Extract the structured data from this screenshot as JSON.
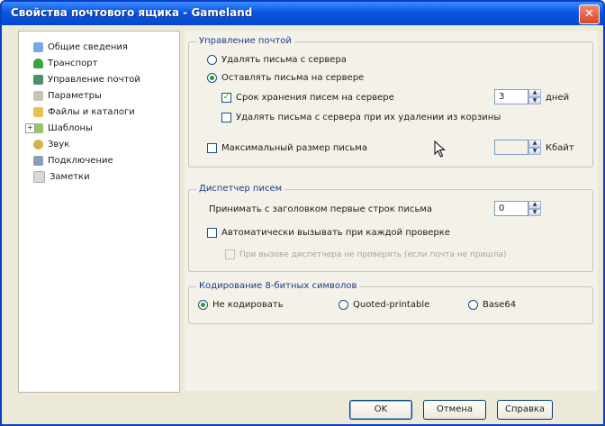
{
  "window": {
    "title": "Свойства почтового ящика - Gameland",
    "close_glyph": "✕"
  },
  "tree": {
    "items": [
      {
        "label": "Общие сведения",
        "icon": "info-icon"
      },
      {
        "label": "Транспорт",
        "icon": "transport-icon"
      },
      {
        "label": "Управление почтой",
        "icon": "mail-management-icon"
      },
      {
        "label": "Параметры",
        "icon": "parameters-icon"
      },
      {
        "label": "Файлы и каталоги",
        "icon": "folder-icon"
      },
      {
        "label": "Шаблоны",
        "icon": "templates-icon",
        "expander": "+"
      },
      {
        "label": "Звук",
        "icon": "sound-icon"
      },
      {
        "label": "Подключение",
        "icon": "connection-icon"
      },
      {
        "label": "Заметки",
        "icon": "notes-icon"
      }
    ]
  },
  "mail_group": {
    "legend": "Управление почтой",
    "radio_delete": "Удалять письма с сервера",
    "radio_keep": "Оставлять письма на сервере",
    "check_storage": "Срок хранения писем на сервере",
    "storage_value": "3",
    "storage_unit": "дней",
    "check_delete_from_trash": "Удалять письма с сервера при их удалении из корзины",
    "check_max_size": "Максимальный размер письма",
    "max_size_value": "",
    "max_size_unit": "Кбайт"
  },
  "dispatcher_group": {
    "legend": "Диспетчер писем",
    "receive_lines_label": "Принимать с заголовком первые строк письма",
    "receive_lines_value": "0",
    "check_auto_call": "Автоматически вызывать при каждой проверке",
    "disabled_option": "При вызове диспетчера не проверять (если почта не пришла)"
  },
  "encoding_group": {
    "legend": "Кодирование 8-битных символов",
    "options": [
      "Не кодировать",
      "Quoted-printable",
      "Base64"
    ]
  },
  "buttons": {
    "ok": "OK",
    "cancel": "Отмена",
    "help": "Справка"
  },
  "colors": {
    "titlebar": "#0a56e0",
    "face": "#ece9d8",
    "accent": "#21a121"
  }
}
